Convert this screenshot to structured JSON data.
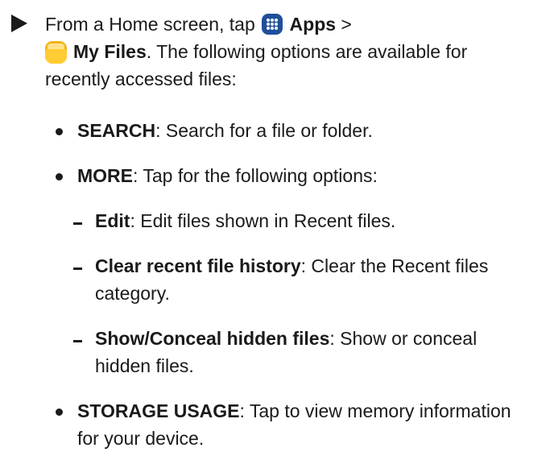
{
  "step": {
    "prefix": "From a Home screen, tap ",
    "apps_label": "Apps",
    "separator": " >",
    "my_files_label": "My Files",
    "suffix": ". The following options are available for recently accessed files:"
  },
  "options": [
    {
      "term": "SEARCH",
      "desc": ": Search for a file or folder."
    },
    {
      "term": "MORE",
      "desc": ": Tap for the following options:"
    },
    {
      "term": "STORAGE USAGE",
      "desc": ": Tap to view memory information for your device."
    }
  ],
  "more_options": [
    {
      "term": "Edit",
      "desc": ": Edit files shown in Recent files."
    },
    {
      "term": "Clear recent file history",
      "desc": ": Clear the Recent files category."
    },
    {
      "term": "Show/Conceal hidden files",
      "desc": ": Show or conceal hidden files."
    }
  ],
  "icons": {
    "step_marker": "triangle-arrow-icon",
    "apps": "apps-grid-icon",
    "my_files": "my-files-folder-icon"
  },
  "colors": {
    "apps_icon": "#1f4f9a",
    "my_files_icon": "#ffcc33",
    "text": "#1a1a1a"
  }
}
